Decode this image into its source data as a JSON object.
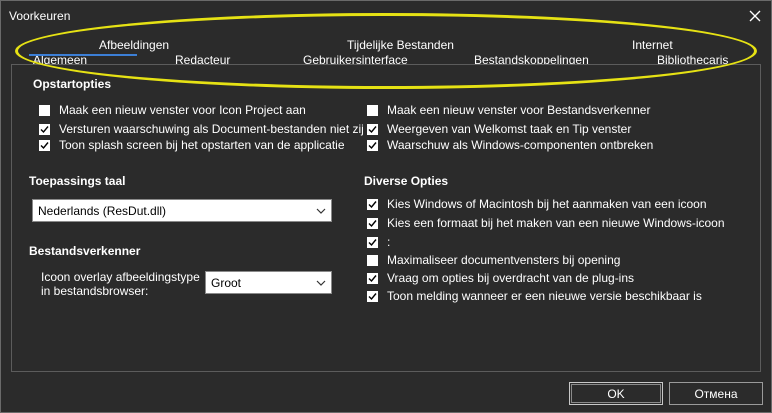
{
  "window": {
    "title": "Voorkeuren"
  },
  "tabs_row1": [
    "Afbeeldingen",
    "Tijdelijke Bestanden",
    "Internet"
  ],
  "tabs_row2": [
    "Algemeen",
    "Redacteur",
    "Gebruikersinterface",
    "Bestandskoppelingen",
    "Bibliothecaris"
  ],
  "sections": {
    "startup": "Opstartopties",
    "language": "Toepassings taal",
    "explorer": "Bestandsverkenner",
    "misc": "Diverse Opties"
  },
  "startup_left": [
    {
      "label": "Maak een nieuw venster voor Icon Project aan",
      "checked": false
    },
    {
      "label": "Versturen waarschuwing als Document-bestanden niet zij",
      "checked": true
    },
    {
      "label": "Toon splash screen bij het opstarten van de applicatie",
      "checked": true
    }
  ],
  "startup_right": [
    {
      "label": "Maak een nieuw venster voor Bestandsverkenner",
      "checked": false
    },
    {
      "label": "Weergeven van Welkomst taak en Tip venster",
      "checked": true
    },
    {
      "label": "Waarschuw als Windows-componenten ontbreken",
      "checked": true
    }
  ],
  "language": {
    "selected": "Nederlands (ResDut.dll)"
  },
  "explorer": {
    "overlay_label_line1": "Icoon overlay afbeeldingstype",
    "overlay_label_line2": "in bestandsbrowser:",
    "overlay_selected": "Groot"
  },
  "misc_options": [
    {
      "label": "Kies Windows of Macintosh bij het aanmaken van een icoon",
      "checked": true
    },
    {
      "label": "Kies een formaat bij het maken van een nieuwe Windows-icoon",
      "checked": true
    },
    {
      "label": ":",
      "checked": true
    },
    {
      "label": "Maximaliseer documentvensters bij opening",
      "checked": false
    },
    {
      "label": "Vraag om opties bij overdracht van de plug-ins",
      "checked": true
    },
    {
      "label": "Toon melding wanneer er een nieuwe versie beschikbaar is",
      "checked": true
    }
  ],
  "buttons": {
    "ok": "OK",
    "cancel": "Отмена"
  },
  "colors": {
    "background": "#2b2b2b",
    "highlight_ellipse": "#e6e214",
    "active_tab": "#3c7fd6"
  }
}
